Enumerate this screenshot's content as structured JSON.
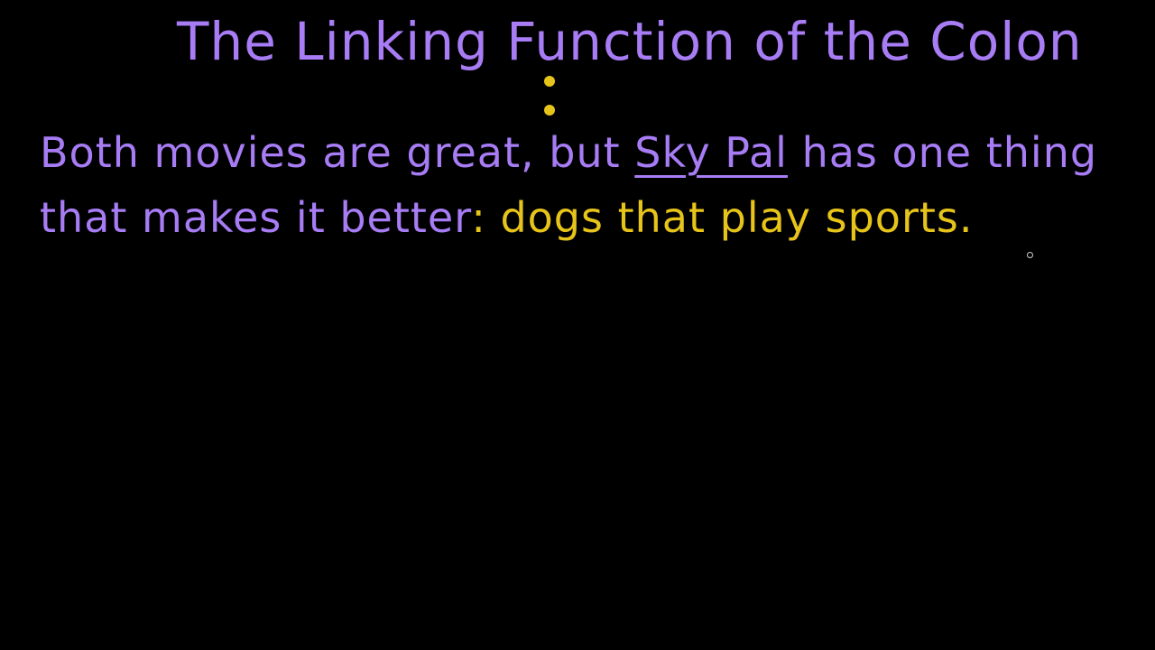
{
  "title": "The Linking Function of the Colon",
  "sentence": {
    "line1_before": "Both movies are great, but ",
    "title_ref": "Sky Pal",
    "line1_after": " has one thing",
    "line2_main": "that makes it better",
    "colon": ":",
    "line2_explanation": " dogs that play sports."
  },
  "colors": {
    "background": "#000000",
    "main_text": "#a77cf4",
    "highlight": "#e7c419"
  }
}
